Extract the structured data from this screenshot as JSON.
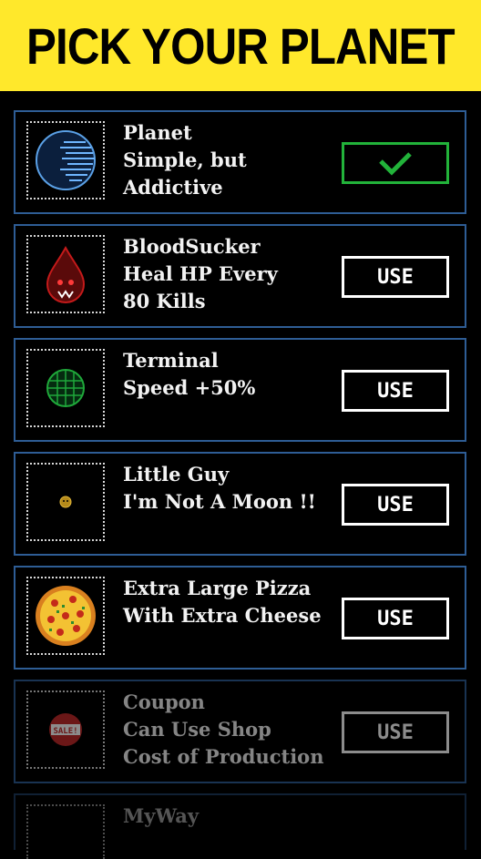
{
  "header": {
    "title": "PICK YOUR PLANET"
  },
  "planets": [
    {
      "name": "Planet",
      "lines": [
        "Simple, but",
        "Addictive"
      ],
      "button": "",
      "selected": true,
      "icon": "planet-icon"
    },
    {
      "name": "BloodSucker",
      "lines": [
        "Heal HP Every",
        "80 Kills"
      ],
      "button": "USE",
      "selected": false,
      "icon": "blood-drop-icon"
    },
    {
      "name": "Terminal",
      "lines": [
        "Speed +50%"
      ],
      "button": "USE",
      "selected": false,
      "icon": "terminal-globe-icon"
    },
    {
      "name": "Little Guy",
      "lines": [
        "I'm Not A Moon !!"
      ],
      "button": "USE",
      "selected": false,
      "icon": "little-guy-icon"
    },
    {
      "name": "Extra Large Pizza",
      "lines": [
        "With Extra Cheese"
      ],
      "button": "USE",
      "selected": false,
      "icon": "pizza-icon"
    },
    {
      "name": "Coupon",
      "lines": [
        "Can Use Shop",
        "Cost of Production"
      ],
      "button": "USE",
      "selected": false,
      "icon": "sale-coupon-icon"
    },
    {
      "name": "MyWay",
      "lines": [],
      "button": "",
      "selected": false,
      "icon": "myway-icon"
    }
  ],
  "colors": {
    "header_bg": "#ffe82b",
    "card_border": "#2e5d95",
    "selected_green": "#22b33a"
  }
}
